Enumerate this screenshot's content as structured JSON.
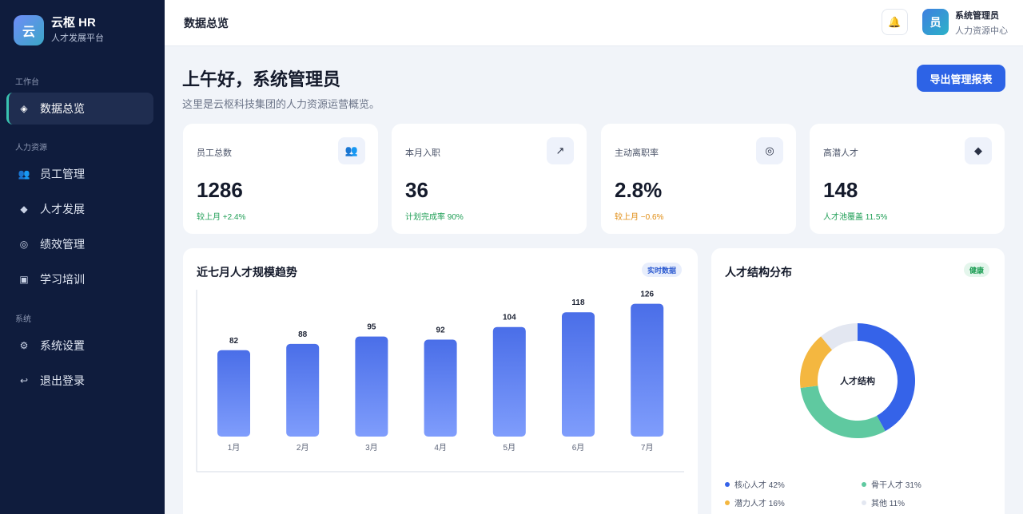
{
  "brand": {
    "logo_char": "云",
    "name": "云枢 HR",
    "subtitle": "人才发展平台"
  },
  "sidebar": {
    "sections": [
      "工作台",
      "人力资源",
      "系统"
    ],
    "items": [
      {
        "label": "数据总览",
        "icon": "diamond-icon",
        "glyph": "◈",
        "active": true
      },
      {
        "label": "员工管理",
        "icon": "people-icon",
        "glyph": "👥",
        "active": false
      },
      {
        "label": "人才发展",
        "icon": "diamond-solid-icon",
        "glyph": "◆",
        "active": false
      },
      {
        "label": "绩效管理",
        "icon": "target-icon",
        "glyph": "◎",
        "active": false
      },
      {
        "label": "学习培训",
        "icon": "square-icon",
        "glyph": "▣",
        "active": false
      },
      {
        "label": "系统设置",
        "icon": "gear-icon",
        "glyph": "⚙",
        "active": false
      },
      {
        "label": "退出登录",
        "icon": "logout-icon",
        "glyph": "↩",
        "active": false
      }
    ]
  },
  "topbar": {
    "title": "数据总览",
    "bell_glyph": "🔔",
    "user": {
      "avatar_char": "员",
      "name": "系统管理员",
      "role": "人力资源中心"
    }
  },
  "main": {
    "greeting": "上午好，系统管理员",
    "subtitle": "这里是云枢科技集团的人力资源运营概览。",
    "export_label": "导出管理报表"
  },
  "stats": [
    {
      "label": "员工总数",
      "value": "1286",
      "sub": "较上月 +2.4%",
      "tone": "green",
      "icon": "people-icon",
      "glyph": "👥"
    },
    {
      "label": "本月入职",
      "value": "36",
      "sub": "计划完成率 90%",
      "tone": "green",
      "icon": "arrow-up-right-icon",
      "glyph": "↗"
    },
    {
      "label": "主动离职率",
      "value": "2.8%",
      "sub": "较上月 −0.6%",
      "tone": "orange",
      "icon": "target-icon",
      "glyph": "◎"
    },
    {
      "label": "高潜人才",
      "value": "148",
      "sub": "人才池覆盖 11.5%",
      "tone": "green",
      "icon": "diamond-solid-icon",
      "glyph": "◆"
    }
  ],
  "trend_panel": {
    "title": "近七月人才规模趋势",
    "badge": "实时数据"
  },
  "structure_panel": {
    "title": "人才结构分布",
    "badge": "健康",
    "center_label": "人才结构"
  },
  "chart_data": [
    {
      "type": "bar",
      "categories": [
        "1月",
        "2月",
        "3月",
        "4月",
        "5月",
        "6月",
        "7月"
      ],
      "values": [
        82,
        88,
        95,
        92,
        104,
        118,
        126
      ],
      "title": "近七月人才规模趋势",
      "ylim": [
        0,
        130
      ],
      "colors": {
        "top": "#4a6ee8",
        "bottom": "#7f9dfc"
      }
    },
    {
      "type": "pie",
      "title": "人才结构分布",
      "slices": [
        {
          "name": "核心人才",
          "value": 42,
          "label": "核心人才 42%",
          "color": "#3563e9"
        },
        {
          "name": "骨干人才",
          "value": 31,
          "label": "骨干人才 31%",
          "color": "#5fc9a0"
        },
        {
          "name": "潜力人才",
          "value": 16,
          "label": "潜力人才 16%",
          "color": "#f4b740"
        },
        {
          "name": "其他",
          "value": 11,
          "label": "其他 11%",
          "color": "#e3e7f1"
        }
      ]
    }
  ]
}
